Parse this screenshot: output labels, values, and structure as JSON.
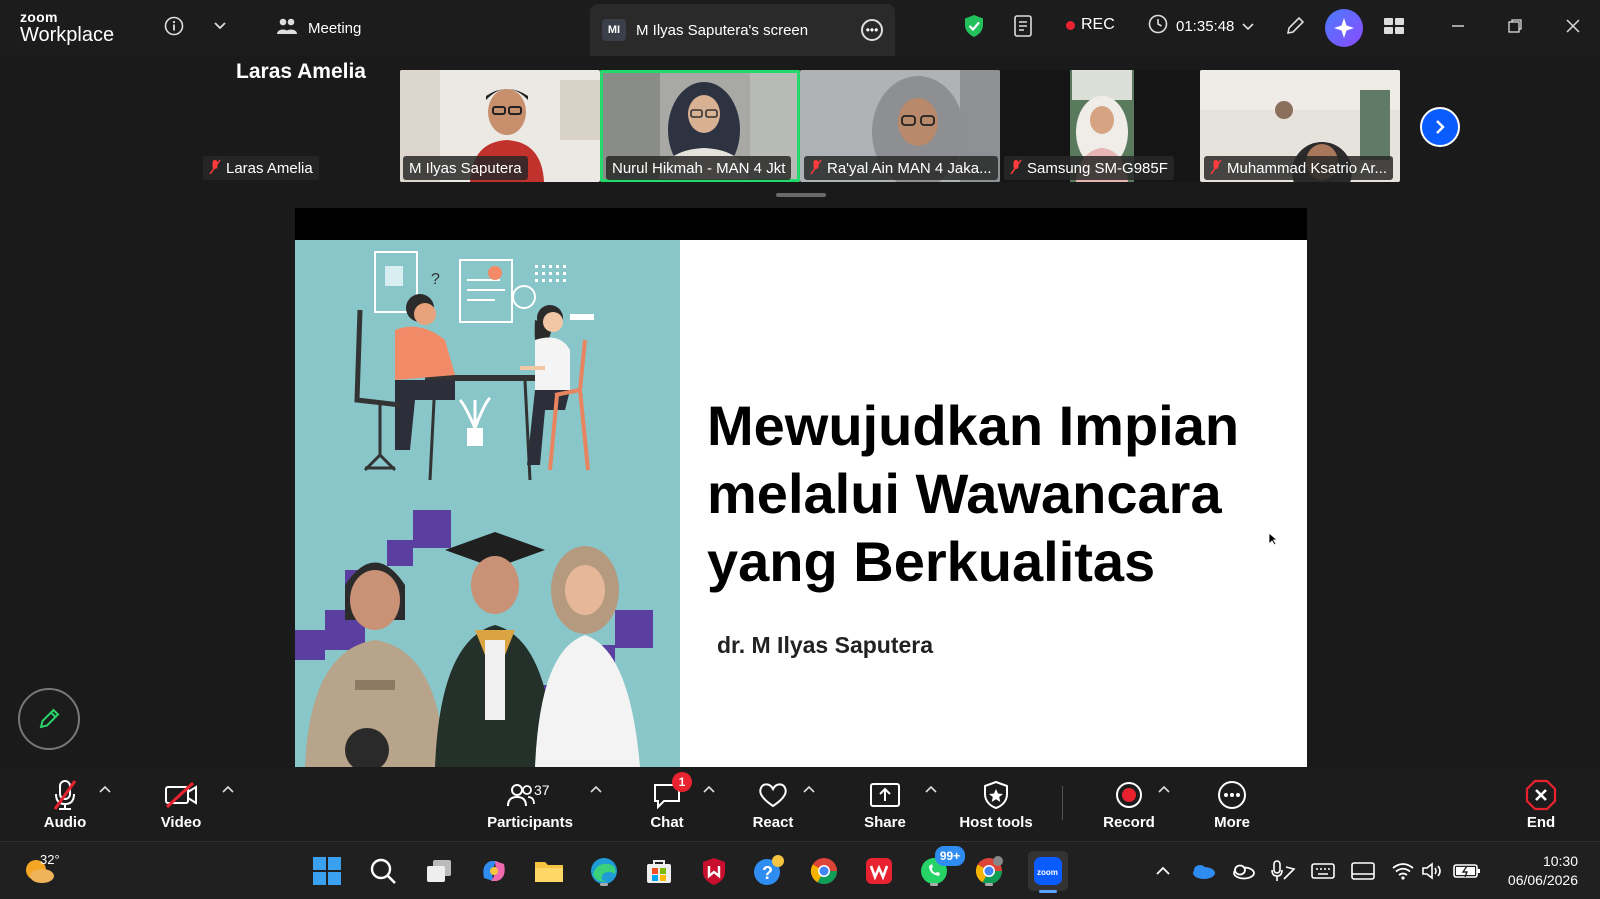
{
  "titlebar": {
    "logo_small": "zoom",
    "logo_big": "Workplace",
    "meeting_label": "Meeting",
    "screen_tab_initials": "MI",
    "screen_tab_label": "M Ilyas Saputera's screen",
    "rec_label": "REC",
    "timer": "01:35:48"
  },
  "strip": {
    "active_speaker_name": "Laras Amelia",
    "active_speaker_tag": "Laras Amelia",
    "thumbnails": [
      {
        "name": "M Ilyas Saputera",
        "muted": false
      },
      {
        "name": "Nurul Hikmah - MAN 4 Jkt",
        "muted": false
      },
      {
        "name": "Ra'yal Ain MAN 4 Jaka...",
        "muted": true
      },
      {
        "name": "Samsung SM-G985F",
        "muted": true
      },
      {
        "name": "Muhammad Ksatrio Ar...",
        "muted": true
      }
    ]
  },
  "slide": {
    "title_line1": "Mewujudkan Impian",
    "title_line2": "melalui Wawancara",
    "title_line3": "yang Berkualitas",
    "author": "dr. M Ilyas Saputera"
  },
  "controls": {
    "audio": "Audio",
    "video": "Video",
    "participants": "Participants",
    "participants_count": "37",
    "chat": "Chat",
    "chat_badge": "1",
    "react": "React",
    "share": "Share",
    "host_tools": "Host tools",
    "record": "Record",
    "more": "More",
    "end": "End"
  },
  "taskbar": {
    "temperature": "32°",
    "whatsapp_badge": "99+",
    "time": "10:30",
    "date": "06/06/2026"
  },
  "colors": {
    "accent_green": "#23d96b",
    "zoom_blue": "#0b5cff",
    "rec_red": "#e8232f",
    "slide_teal": "#89c6c9",
    "slide_purple": "#5b3fa0"
  }
}
